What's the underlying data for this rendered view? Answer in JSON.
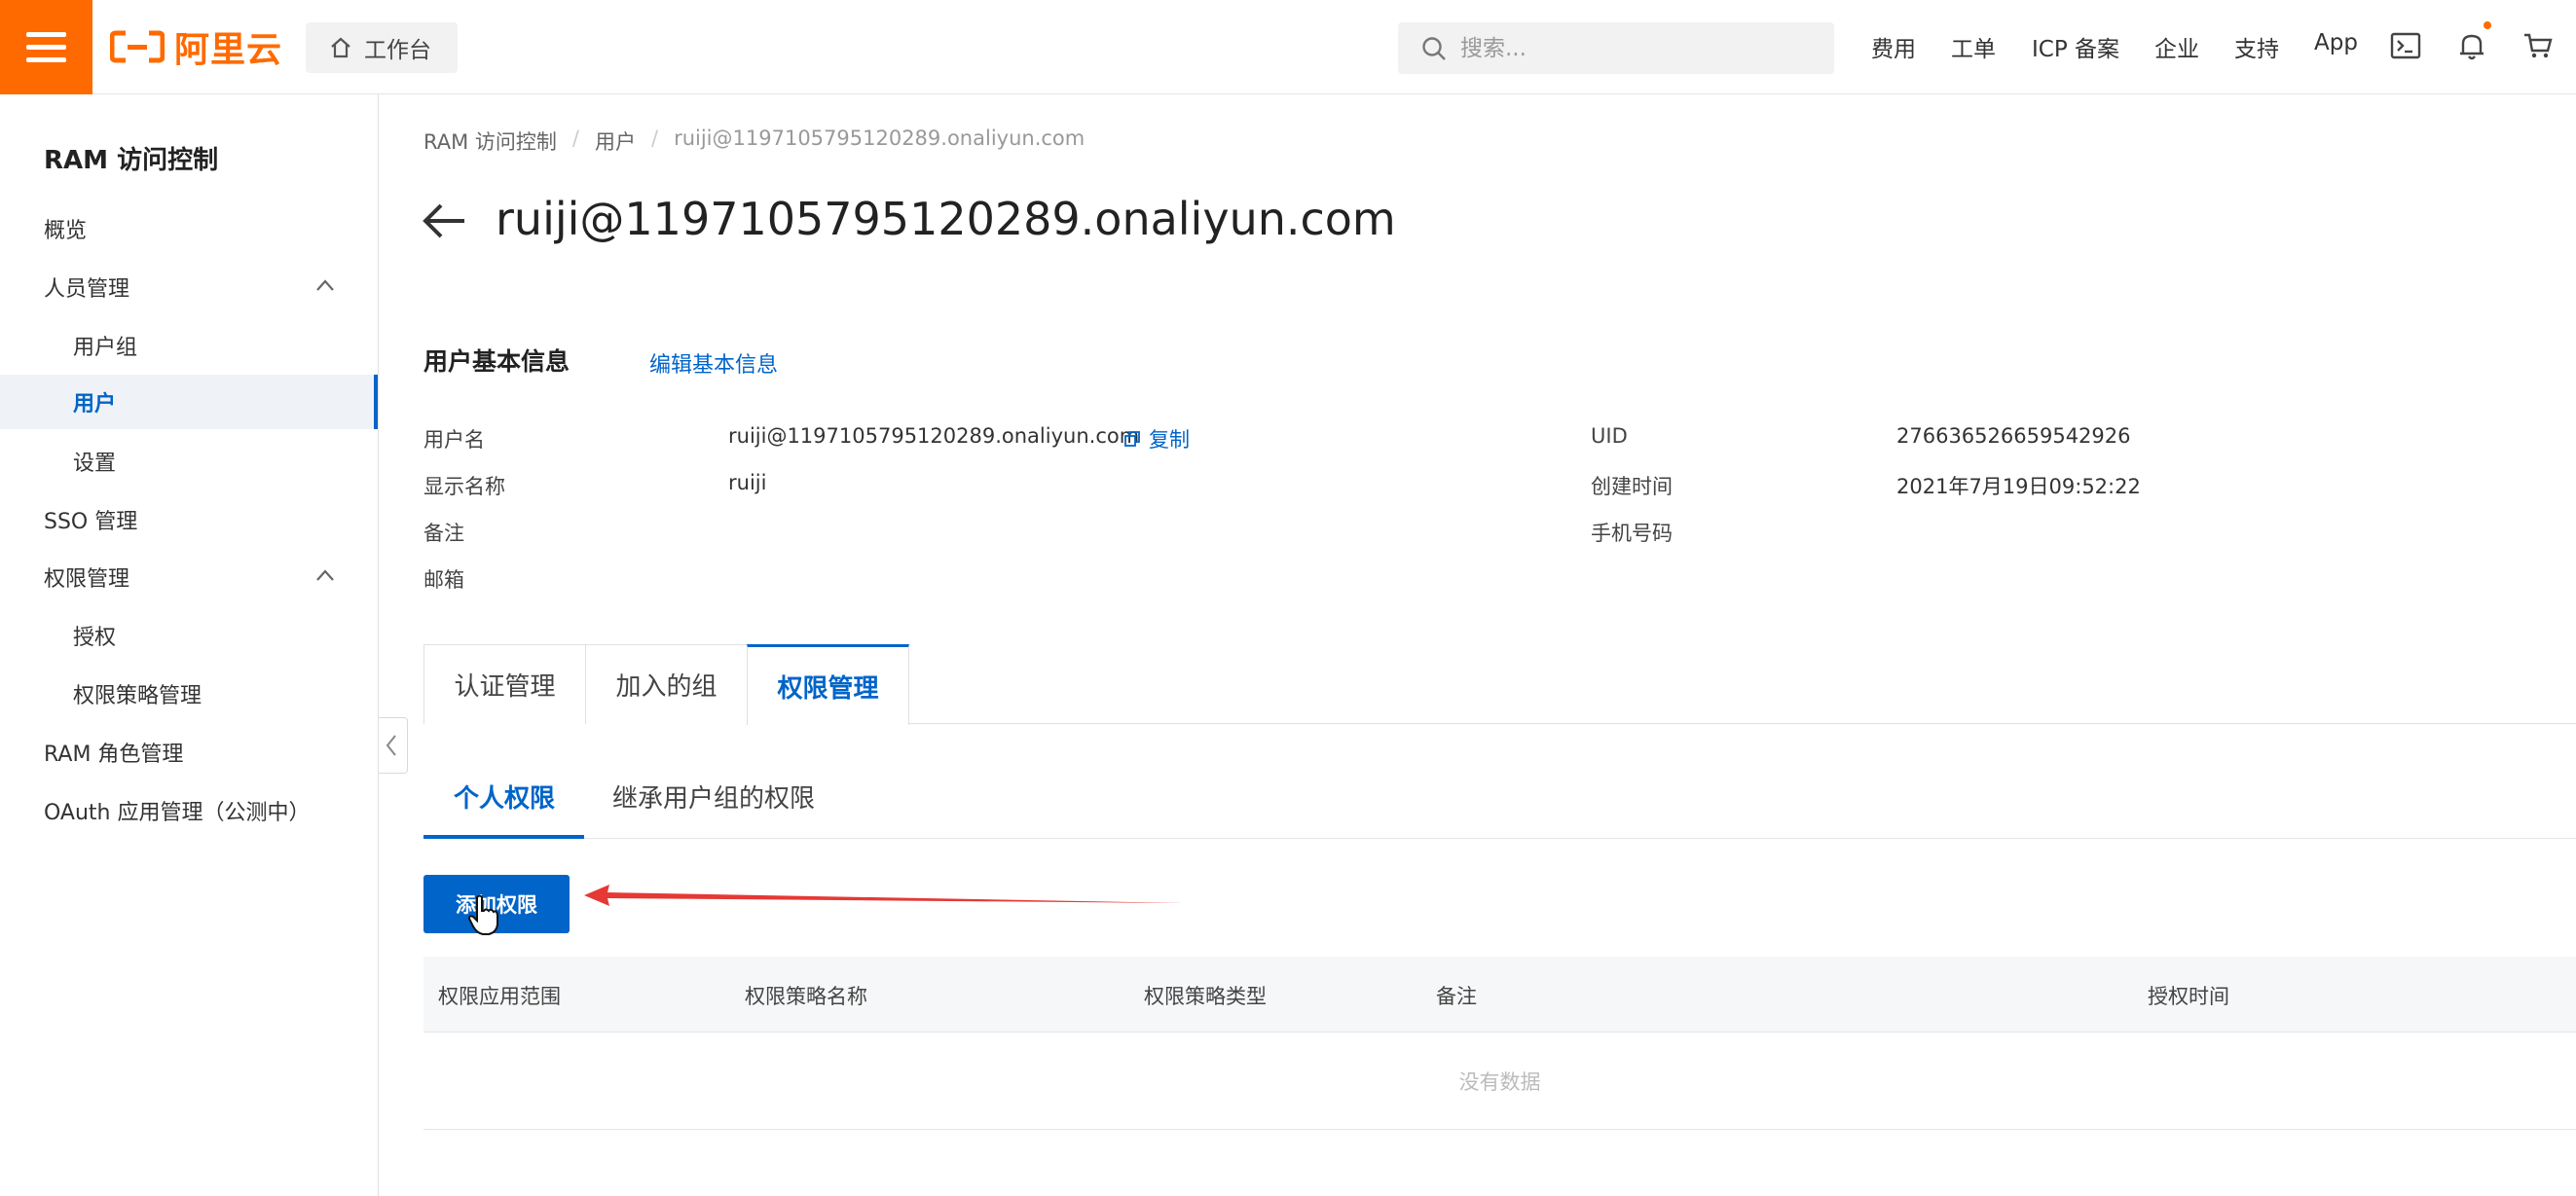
{
  "topbar": {
    "logo_text": "阿里云",
    "workbench_label": "工作台",
    "search_placeholder": "搜索...",
    "nav": [
      "费用",
      "工单",
      "ICP 备案",
      "企业",
      "支持",
      "App"
    ],
    "icons": [
      "terminal-icon",
      "bell-icon",
      "cart-icon"
    ],
    "accent_color": "#ff6a00"
  },
  "sidebar": {
    "title": "RAM 访问控制",
    "items": [
      {
        "label": "概览",
        "level": 1
      },
      {
        "label": "人员管理",
        "level": 1,
        "expanded": true
      },
      {
        "label": "用户组",
        "level": 2
      },
      {
        "label": "用户",
        "level": 2,
        "active": true
      },
      {
        "label": "设置",
        "level": 2
      },
      {
        "label": "SSO 管理",
        "level": 1
      },
      {
        "label": "权限管理",
        "level": 1,
        "expanded": true
      },
      {
        "label": "授权",
        "level": 2
      },
      {
        "label": "权限策略管理",
        "level": 2
      },
      {
        "label": "RAM 角色管理",
        "level": 1
      },
      {
        "label": "OAuth 应用管理（公测中）",
        "level": 1
      }
    ]
  },
  "breadcrumb": [
    "RAM 访问控制",
    "用户",
    "ruiji@1197105795120289.onaliyun.com"
  ],
  "page_title": "ruiji@1197105795120289.onaliyun.com",
  "basic_info": {
    "title": "用户基本信息",
    "edit_link": "编辑基本信息",
    "copy_label": "复制",
    "left": [
      {
        "label": "用户名",
        "value": "ruiji@1197105795120289.onaliyun.com"
      },
      {
        "label": "显示名称",
        "value": "ruiji"
      },
      {
        "label": "备注",
        "value": ""
      },
      {
        "label": "邮箱",
        "value": ""
      }
    ],
    "right": [
      {
        "label": "UID",
        "value": "276636526659542926"
      },
      {
        "label": "创建时间",
        "value": "2021年7月19日09:52:22"
      },
      {
        "label": "手机号码",
        "value": ""
      }
    ]
  },
  "tabs": [
    {
      "label": "认证管理"
    },
    {
      "label": "加入的组"
    },
    {
      "label": "权限管理",
      "active": true
    }
  ],
  "subtabs": [
    {
      "label": "个人权限",
      "active": true
    },
    {
      "label": "继承用户组的权限"
    }
  ],
  "add_button": "添加权限",
  "table": {
    "columns": [
      "权限应用范围",
      "权限策略名称",
      "权限策略类型",
      "备注",
      "授权时间"
    ],
    "empty_text": "没有数据"
  },
  "colors": {
    "primary": "#0064c8",
    "annotation_arrow": "#e53935"
  }
}
